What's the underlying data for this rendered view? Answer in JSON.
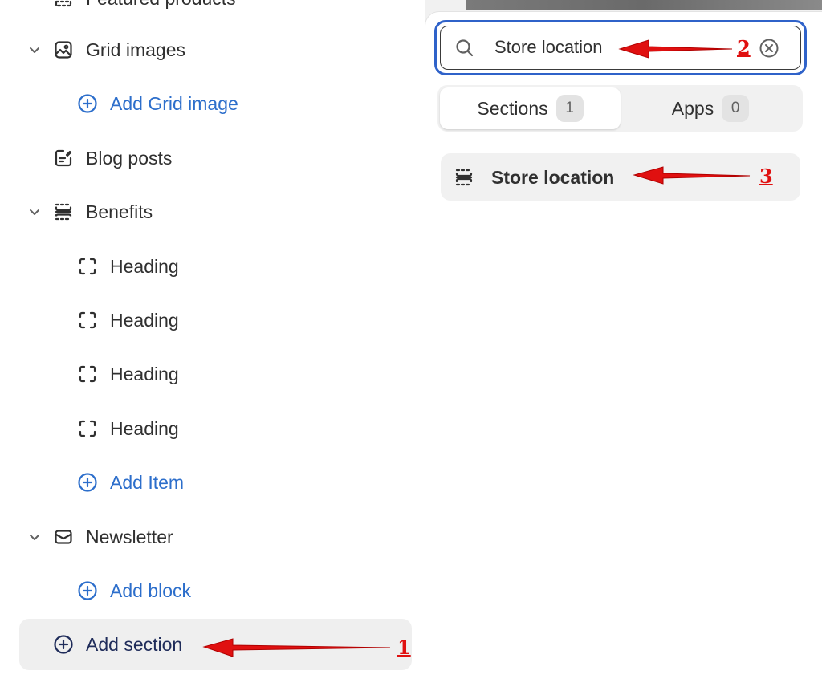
{
  "sidebar": {
    "items": [
      {
        "label": "Featured products",
        "icon": "dashed-section-icon",
        "type": "section"
      },
      {
        "label": "Grid images",
        "icon": "image-icon",
        "type": "section",
        "expanded": true
      },
      {
        "label": "Add Grid image",
        "icon": "plus-circle-icon",
        "type": "add-link"
      },
      {
        "label": "Blog posts",
        "icon": "blog-edit-icon",
        "type": "section"
      },
      {
        "label": "Benefits",
        "icon": "dashed-section-icon",
        "type": "section",
        "expanded": true
      },
      {
        "label": "Heading",
        "icon": "dashed-block-icon",
        "type": "block"
      },
      {
        "label": "Heading",
        "icon": "dashed-block-icon",
        "type": "block"
      },
      {
        "label": "Heading",
        "icon": "dashed-block-icon",
        "type": "block"
      },
      {
        "label": "Heading",
        "icon": "dashed-block-icon",
        "type": "block"
      },
      {
        "label": "Add Item",
        "icon": "plus-circle-icon",
        "type": "add-link"
      },
      {
        "label": "Newsletter",
        "icon": "mail-icon",
        "type": "section",
        "expanded": true
      },
      {
        "label": "Add block",
        "icon": "plus-circle-icon",
        "type": "add-link"
      }
    ],
    "add_section_label": "Add section"
  },
  "panel": {
    "search": {
      "value": "Store location"
    },
    "tabs": [
      {
        "label": "Sections",
        "count": "1",
        "active": true
      },
      {
        "label": "Apps",
        "count": "0",
        "active": false
      }
    ],
    "results": [
      {
        "label": "Store location",
        "icon": "dashed-section-icon"
      }
    ]
  },
  "annotations": [
    {
      "number": "1",
      "target": "add-section-button"
    },
    {
      "number": "2",
      "target": "search-input"
    },
    {
      "number": "3",
      "target": "result-store-location"
    }
  ],
  "colors": {
    "accent_blue": "#2c6ecb",
    "focus_ring": "#2f62c9",
    "annotation_red": "#e01010",
    "text": "#303030"
  }
}
